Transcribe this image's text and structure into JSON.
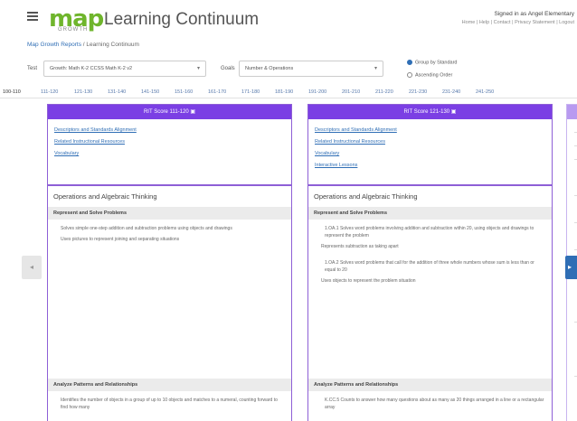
{
  "header": {
    "logo_text": "map",
    "logo_sub": "GROWTH",
    "title": "Learning Continuum",
    "user_line1": "Signed in as Angel Elementary",
    "user_line2": "Home | Help | Contact | Privacy Statement | Logout",
    "brand_color": "#6fb52c"
  },
  "breadcrumb": {
    "link": "Map Growth Reports",
    "separator": " / ",
    "current": "Learning Continuum"
  },
  "filters": {
    "test_label": "Test",
    "test_value": "Growth: Math K-2 CCSS Math K-2 v2",
    "goals_label": "Goals",
    "goals_value": "Number & Operations",
    "radio_1": "Group by Standard",
    "radio_2": "Ascending Order"
  },
  "score_ranges": [
    "100-110",
    "111-120",
    "121-130",
    "131-140",
    "141-150",
    "151-160",
    "161-170",
    "171-180",
    "181-190",
    "191-200",
    "201-210",
    "211-220",
    "221-230",
    "231-240",
    "241-250"
  ],
  "nav": {
    "prev": "◂",
    "next": "▸"
  },
  "columns": [
    {
      "header": "RIT Score 111-120",
      "links": [
        "Descriptors and Standards Alignment",
        "Related Instructional Resources",
        "Vocabulary"
      ],
      "strand": "Operations and Algebraic Thinking",
      "sections": [
        {
          "title": "Represent and Solve Problems",
          "items": [
            "Solves simple one-step addition and subtraction problems using objects and drawings",
            "Uses pictures to represent joining and separating situations"
          ]
        },
        {
          "title": "Analyze Patterns and Relationships",
          "items": [
            "Identifies the number of objects in a group of up to 10 objects and matches to a numeral, counting forward to find how many"
          ]
        }
      ]
    },
    {
      "header": "RIT Score 121-130",
      "links": [
        "Descriptors and Standards Alignment",
        "Related Instructional Resources",
        "Vocabulary",
        "Interactive Lessons"
      ],
      "strand": "Operations and Algebraic Thinking",
      "sections": [
        {
          "title": "Represent and Solve Problems",
          "items": [
            "1.OA.1 Solves word problems involving addition and subtraction within 20, using objects and drawings to represent the problem",
            "Represents subtraction as taking apart",
            "1.OA.2 Solves word problems that call for the addition of three whole numbers whose sum is less than or equal to 20",
            "Uses objects to represent the problem situation"
          ]
        },
        {
          "title": "Analyze Patterns and Relationships",
          "items": [
            "K.CC.5 Counts to answer how many questions about as many as 20 things arranged in a line or a rectangular array"
          ]
        }
      ]
    }
  ]
}
